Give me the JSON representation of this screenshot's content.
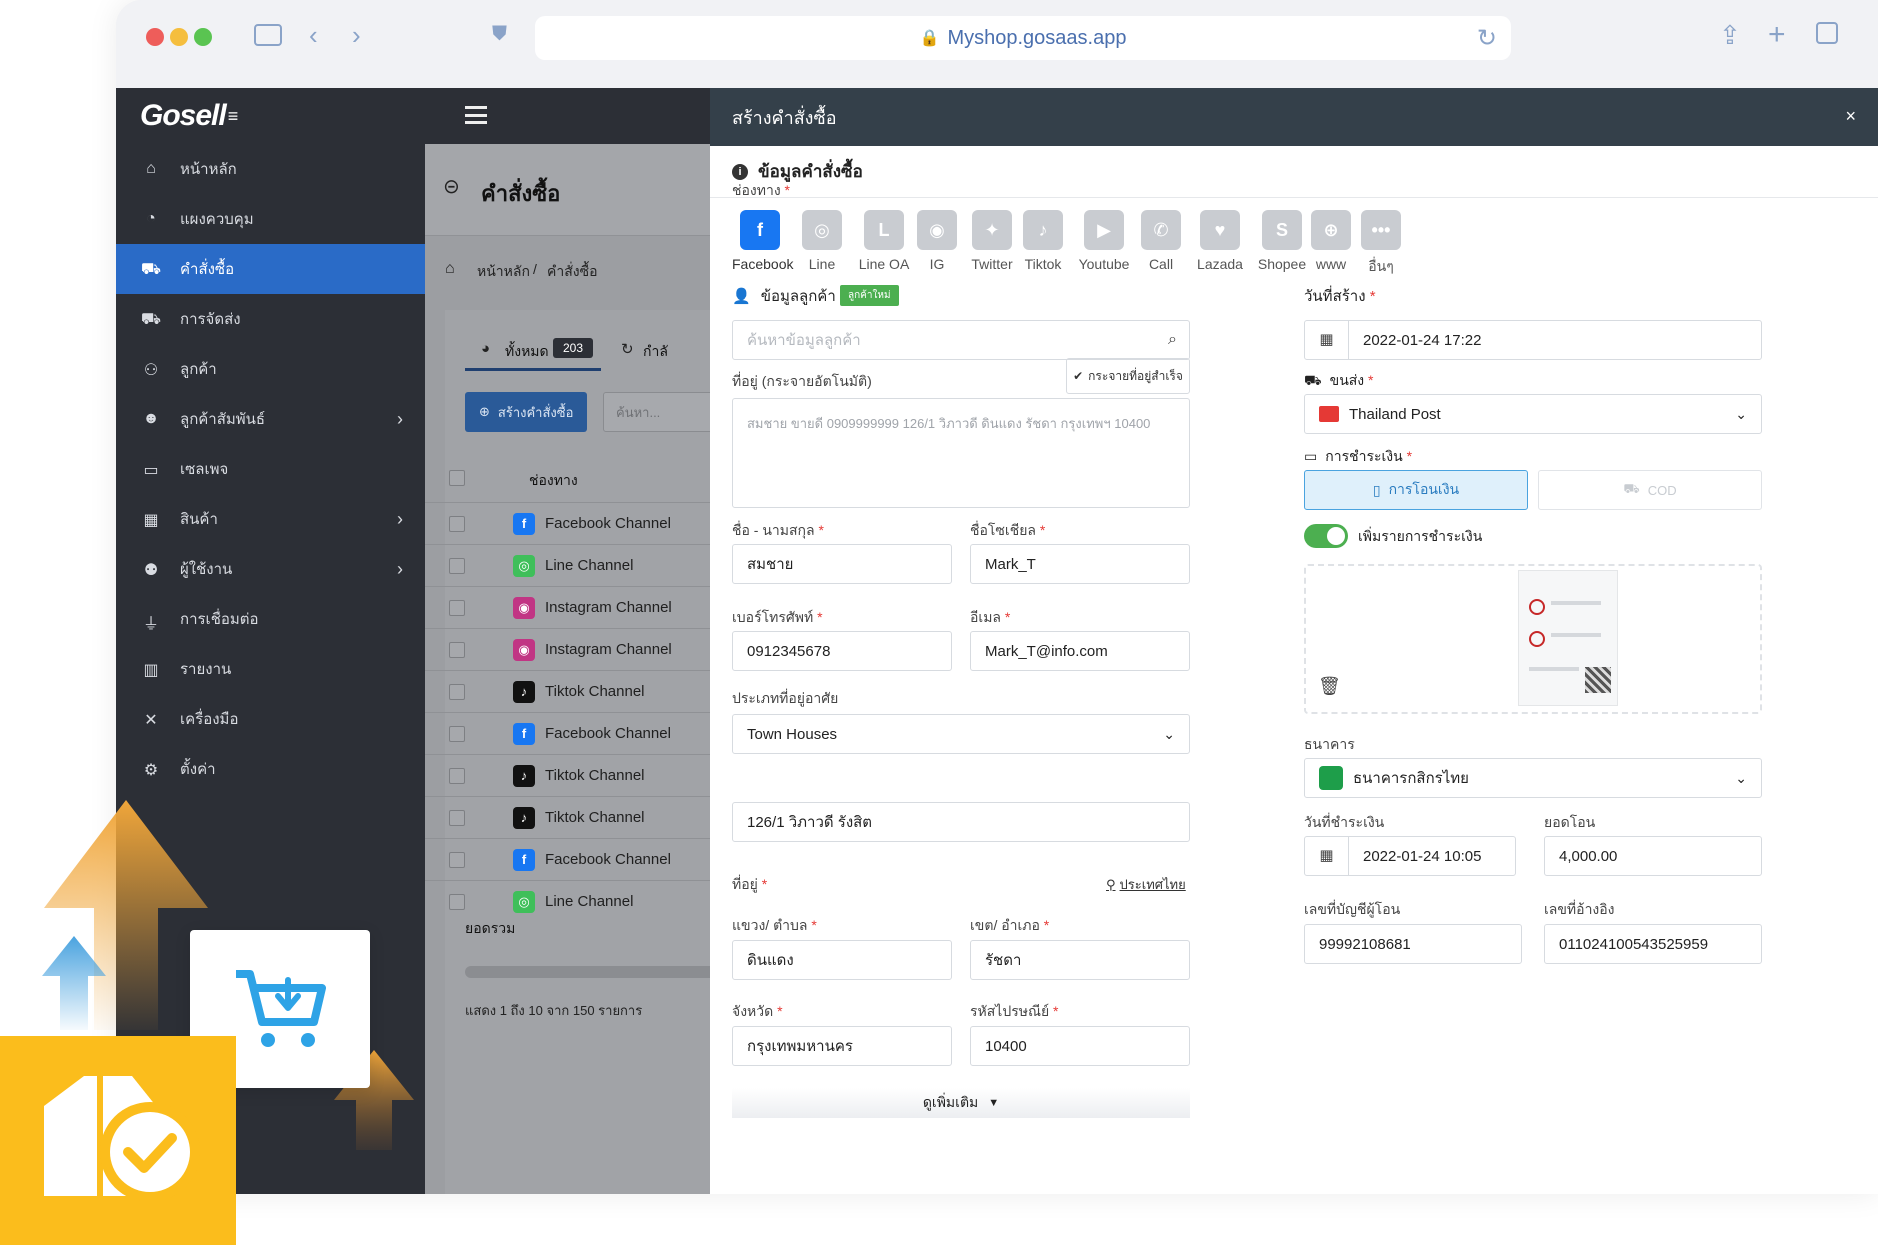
{
  "browser": {
    "url": "Myshop.gosaas.app"
  },
  "sidebar": {
    "logo": "Gosell",
    "items": [
      {
        "label": "หน้าหลัก",
        "icon": "home-icon"
      },
      {
        "label": "แผงควบคุม",
        "icon": "dashboard-icon"
      },
      {
        "label": "คำสั่งซื้อ",
        "icon": "cart-icon",
        "active": true
      },
      {
        "label": "การจัดส่ง",
        "icon": "truck-icon"
      },
      {
        "label": "ลูกค้า",
        "icon": "users-icon"
      },
      {
        "label": "ลูกค้าสัมพันธ์",
        "icon": "crm-icon",
        "has_children": true
      },
      {
        "label": "เซลเพจ",
        "icon": "salepage-icon"
      },
      {
        "label": "สินค้า",
        "icon": "boxes-icon",
        "has_children": true
      },
      {
        "label": "ผู้ใช้งาน",
        "icon": "user-group-icon",
        "has_children": true
      },
      {
        "label": "การเชื่อมต่อ",
        "icon": "plug-icon"
      },
      {
        "label": "รายงาน",
        "icon": "report-icon"
      },
      {
        "label": "เครื่องมือ",
        "icon": "tools-icon"
      },
      {
        "label": "ตั้งค่า",
        "icon": "gear-icon"
      }
    ]
  },
  "orders_page": {
    "title": "คำสั่งซื้อ",
    "breadcrumb_home": "หน้าหลัก",
    "breadcrumb_sep": "/",
    "breadcrumb_current": "คำสั่งซื้อ",
    "tab_all": "ทั้งหมด",
    "tab_all_count": "203",
    "tab_processing": "กำลั",
    "create_button": "สร้างคำสั่งซื้อ",
    "search_placeholder": "ค้นหา...",
    "col_channel": "ช่องทาง",
    "rows": [
      {
        "channel": "Facebook Channel",
        "type": "facebook"
      },
      {
        "channel": "Line Channel",
        "type": "line"
      },
      {
        "channel": "Instagram Channel",
        "type": "instagram"
      },
      {
        "channel": "Instagram Channel",
        "type": "instagram"
      },
      {
        "channel": "Tiktok Channel",
        "type": "tiktok"
      },
      {
        "channel": "Facebook Channel",
        "type": "facebook"
      },
      {
        "channel": "Tiktok Channel",
        "type": "tiktok"
      },
      {
        "channel": "Tiktok Channel",
        "type": "tiktok"
      },
      {
        "channel": "Facebook Channel",
        "type": "facebook"
      },
      {
        "channel": "Line Channel",
        "type": "line"
      }
    ],
    "total_label": "ยอดรวม",
    "pagination_text": "แสดง 1 ถึง 10 จาก 150 รายการ"
  },
  "modal": {
    "title": "สร้างคำสั่งซื้อ",
    "close": "×",
    "section_title": "ข้อมูลคำสั่งซื้อ",
    "channel_label": "ช่องทาง",
    "channels": [
      "Facebook",
      "Line",
      "Line OA",
      "IG",
      "Twitter",
      "Tiktok",
      "Youtube",
      "Call",
      "Lazada",
      "Shopee",
      "www",
      "อื่นๆ"
    ],
    "customer": {
      "label": "ข้อมูลลูกค้า",
      "new_badge": "ลูกค้าใหม่",
      "search_placeholder": "ค้นหาข้อมูลลูกค้า",
      "address_auto_label": "ที่อยู่ (กระจายอัตโนมัติ)",
      "distribute_success": "กระจายที่อยู่สำเร็จ",
      "address_text": "สมชาย ขายดี 0909999999 126/1 วิภาวดี ดินแดง รัชดา กรุงเทพฯ 10400",
      "name_label": "ชื่อ - นามสกุล",
      "name_value": "สมชาย",
      "social_label": "ชื่อโซเชียล",
      "social_value": "Mark_T",
      "phone_label": "เบอร์โทรศัพท์",
      "phone_value": "0912345678",
      "email_label": "อีเมล",
      "email_value": "Mark_T@info.com",
      "residence_label": "ประเภทที่อยู่อาศัย",
      "residence_value": "Town Houses",
      "street_value": "126/1 วิภาวดี รังสิต",
      "address_label": "ที่อยู่",
      "country_link": "ประเทศไทย",
      "subdistrict_label": "แขวง/ ตำบล",
      "subdistrict_value": "ดินแดง",
      "district_label": "เขต/ อำเภอ",
      "district_value": "รัชดา",
      "province_label": "จังหวัด",
      "province_value": "กรุงเทพมหานคร",
      "postcode_label": "รหัสไปรษณีย์",
      "postcode_value": "10400",
      "more": "ดูเพิ่มเติม"
    },
    "order": {
      "created_label": "วันที่สร้าง",
      "created_value": "2022-01-24 17:22",
      "shipping_label": "ขนส่ง",
      "shipping_value": "Thailand Post",
      "payment_label": "การชำระเงิน",
      "payment_transfer": "การโอนเงิน",
      "payment_cod": "COD",
      "add_payment_label": "เพิ่มรายการชำระเงิน",
      "bank_label": "ธนาคาร",
      "bank_value": "ธนาคารกสิกรไทย",
      "paid_date_label": "วันที่ชำระเงิน",
      "paid_date_value": "2022-01-24 10:05",
      "amount_label": "ยอดโอน",
      "amount_value": "4,000.00",
      "sender_account_label": "เลขที่บัญชีผู้โอน",
      "sender_account_value": "99992108681",
      "reference_label": "เลขที่อ้างอิง",
      "reference_value": "011024100543525959"
    }
  },
  "colors": {
    "sidebar_bg": "#2c2f36",
    "active_blue": "#2a6bc7",
    "modal_header": "#34404a",
    "required": "#e53935",
    "badge_green": "#4caf50",
    "promo_yellow": "#fbbd1c",
    "promo_orange": "#f0a63a",
    "promo_blue": "#4aa3df"
  }
}
